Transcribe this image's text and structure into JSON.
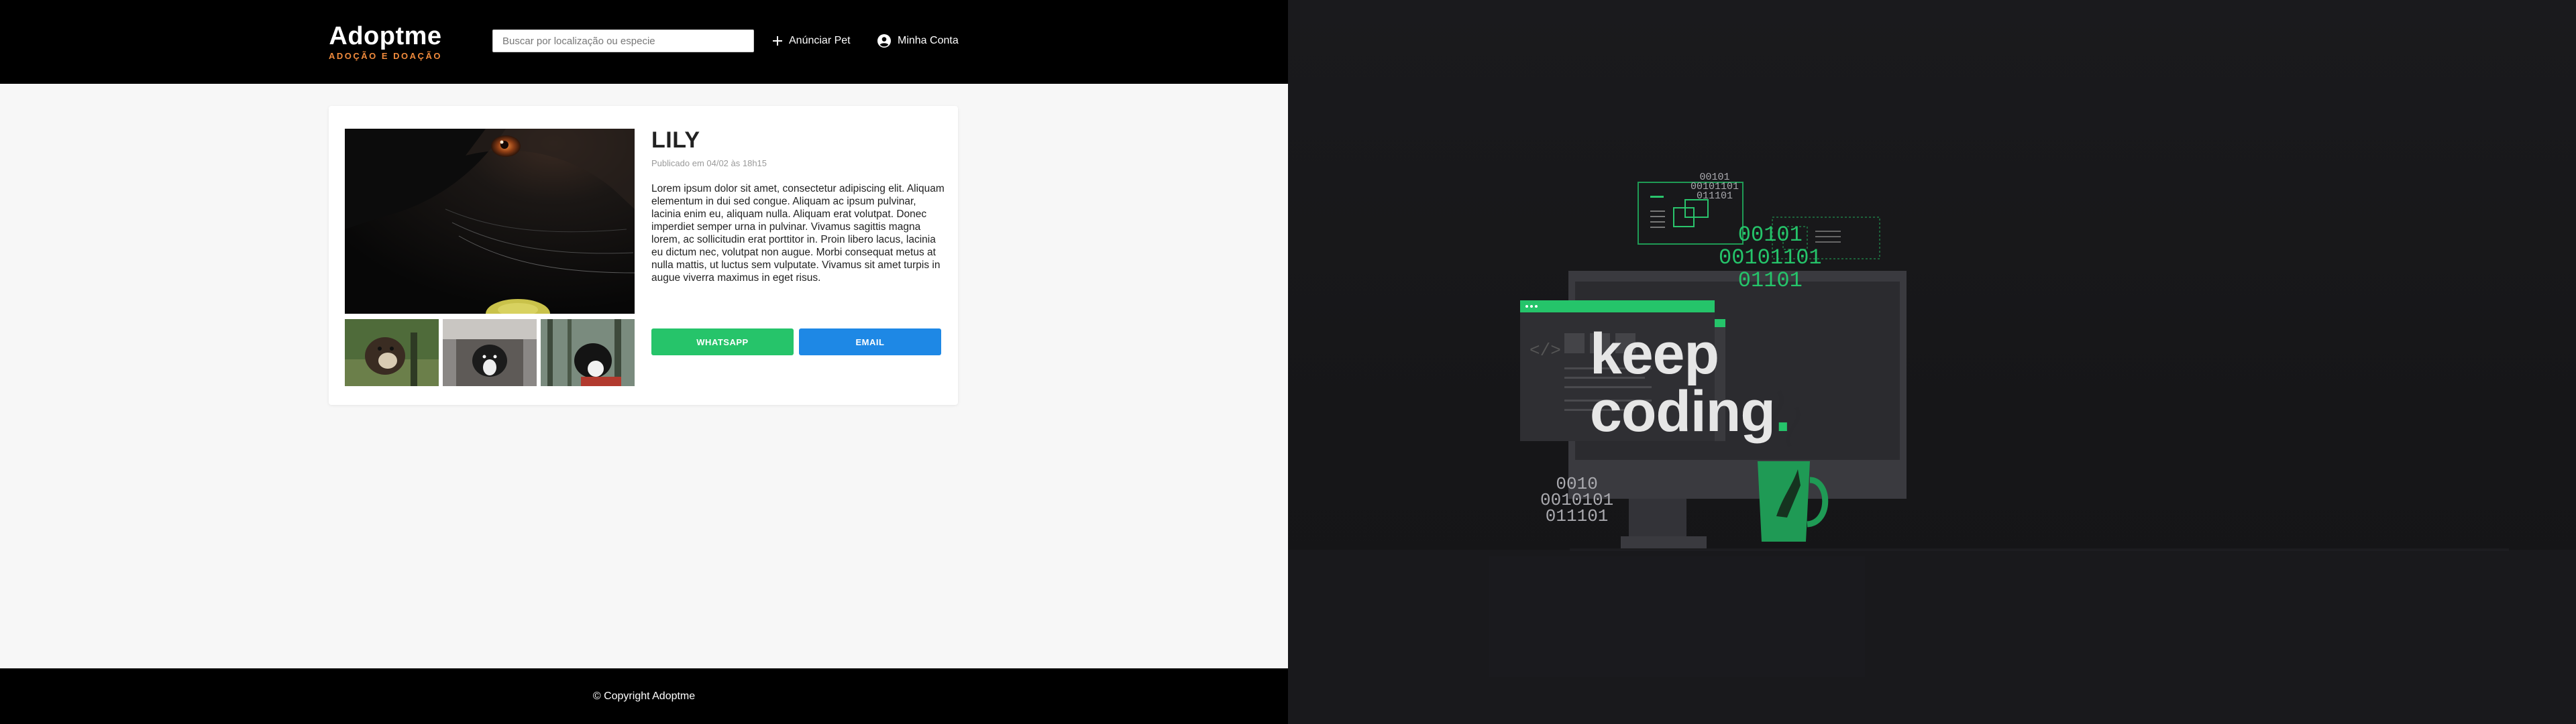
{
  "header": {
    "logo_title": "Adoptme",
    "logo_subtitle": "ADOÇÃO E DOAÇÃO",
    "search_placeholder": "Buscar por localização ou especie",
    "announce_label": "Anúnciar Pet",
    "account_label": "Minha Conta"
  },
  "pet": {
    "name": "LILY",
    "published": "Publicado em 04/02 às 18h15",
    "description": "Lorem ipsum dolor sit amet, consectetur adipiscing elit. Aliquam elementum in dui sed congue. Aliquam ac ipsum pulvinar, lacinia enim eu, aliquam nulla. Aliquam erat volutpat. Donec imperdiet semper urna in pulvinar. Vivamus sagittis magna lorem, ac sollicitudin erat porttitor in. Proin libero lacus, lacinia eu dictum nec, volutpat non augue. Morbi consequat metus at nulla mattis, ut luctus sem vulputate. Vivamus sit amet turpis in augue viverra maximus in eget risus.",
    "whatsapp_label": "WHATSAPP",
    "email_label": "EMAIL"
  },
  "footer": {
    "copyright": "© Copyright Adoptme"
  },
  "wallpaper": {
    "line1": "keep",
    "line2": "coding",
    "dot": ".",
    "binary_top": "00101\n00101101\n011101",
    "binary_green": "00101\n00101101\n01101",
    "binary_left": "0010\n0010101\n011101"
  },
  "colors": {
    "accent_orange": "#f08a3c",
    "whatsapp_green": "#26c46a",
    "email_blue": "#1e88e5",
    "code_green": "#25c46a"
  },
  "icons": {
    "announce": "plus-icon",
    "account": "account-circle-icon"
  }
}
